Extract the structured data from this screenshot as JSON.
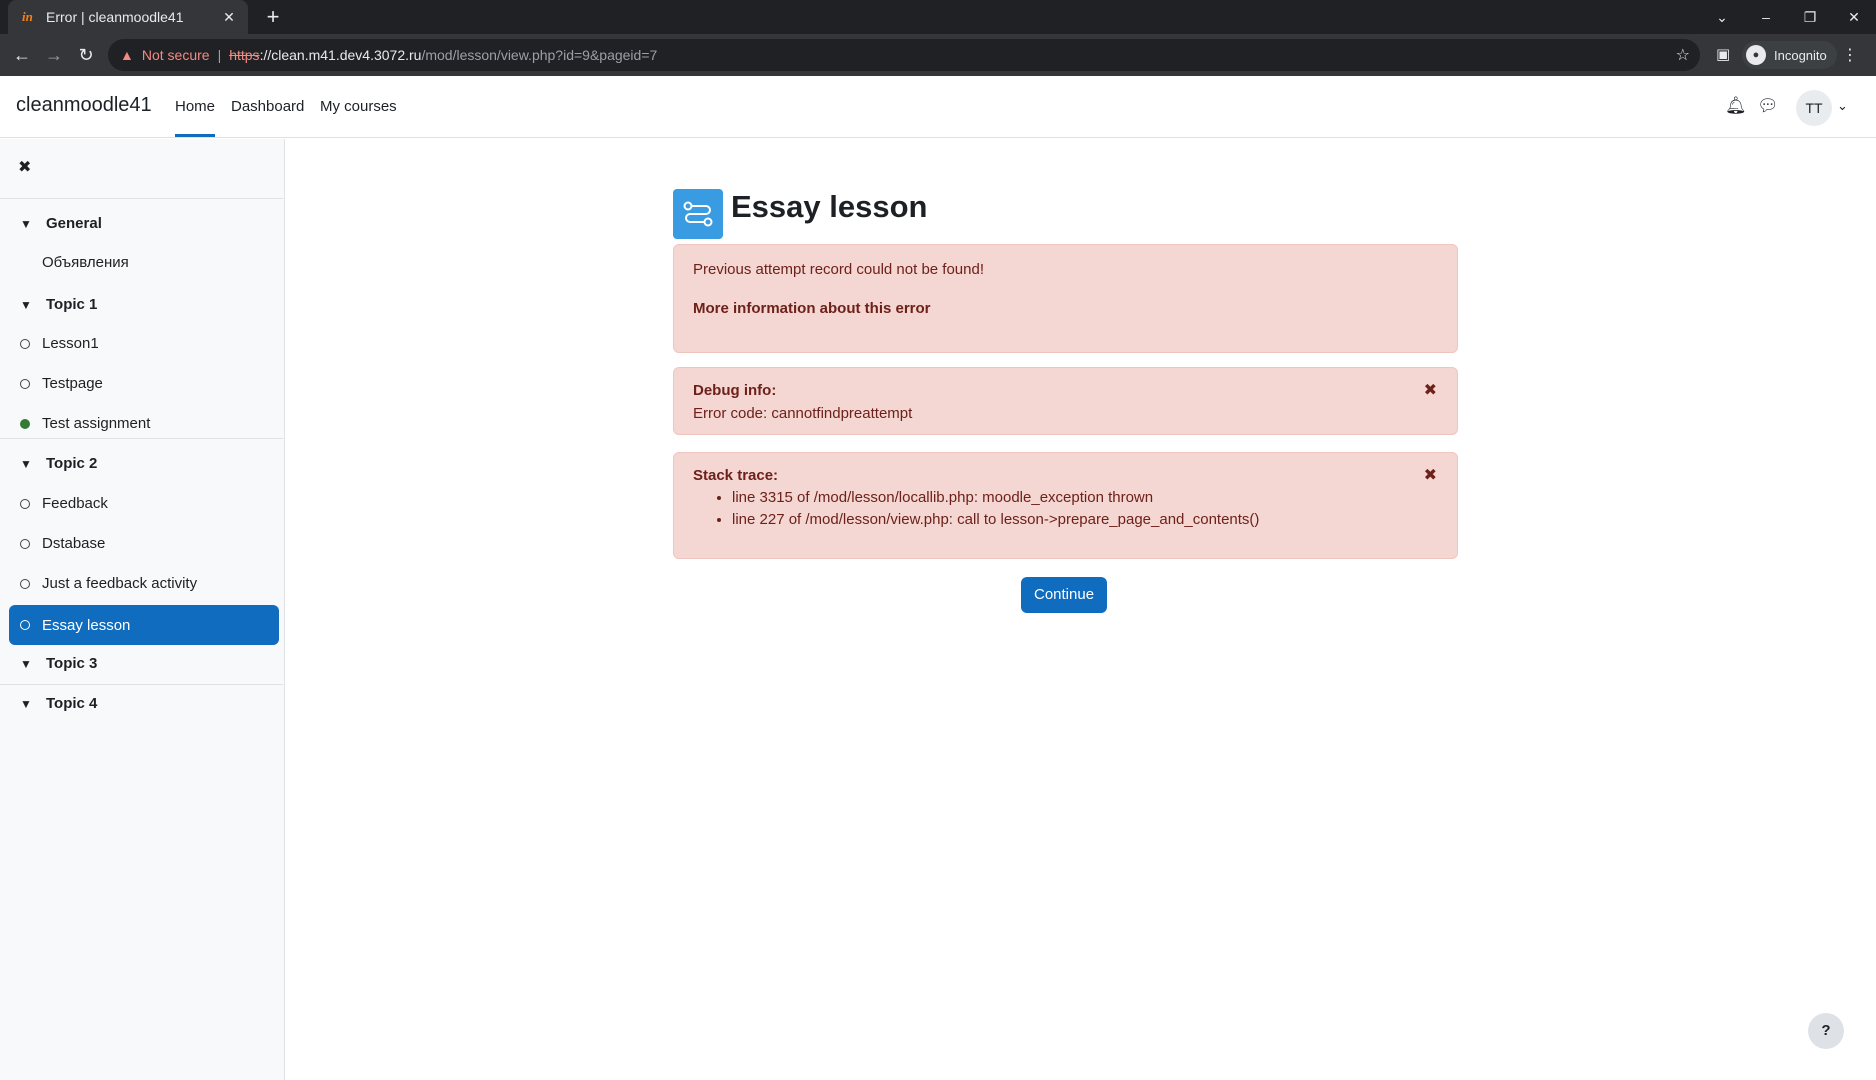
{
  "browser": {
    "tab_title": "Error | cleanmoodle41",
    "tab_favicon": "in",
    "new_tab": "+",
    "address": {
      "security_label": "Not secure",
      "scheme": "https",
      "host": "://clean.m41.dev4.3072.ru",
      "path": "/mod/lesson/view.php?id=9&pageid=7"
    },
    "incognito_label": "Incognito"
  },
  "header": {
    "brand": "cleanmoodle41",
    "nav": [
      "Home",
      "Dashboard",
      "My courses"
    ],
    "avatar_initials": "TT"
  },
  "drawer": {
    "sections": [
      {
        "title": "General",
        "items": [
          {
            "label": "Объявления",
            "status": "none"
          }
        ]
      },
      {
        "title": "Topic 1",
        "items": [
          {
            "label": "Lesson1",
            "status": "open"
          },
          {
            "label": "Testpage",
            "status": "open"
          },
          {
            "label": "Test assignment",
            "status": "done"
          }
        ]
      },
      {
        "title": "Topic 2",
        "items": [
          {
            "label": "Feedback",
            "status": "open"
          },
          {
            "label": "Dstabase",
            "status": "open"
          },
          {
            "label": "Just a feedback activity",
            "status": "open"
          },
          {
            "label": "Essay lesson",
            "status": "open",
            "active": true
          }
        ]
      },
      {
        "title": "Topic 3",
        "items": []
      },
      {
        "title": "Topic 4",
        "items": []
      }
    ]
  },
  "main": {
    "title": "Essay lesson",
    "error_message": "Previous attempt record could not be found!",
    "more_info_link": "More information about this error",
    "debug_title": "Debug info:",
    "debug_line": "Error code: cannotfindpreattempt",
    "stack_title": "Stack trace:",
    "stack_lines": [
      "line 3315 of /mod/lesson/locallib.php: moodle_exception thrown",
      "line 227 of /mod/lesson/view.php: call to lesson->prepare_page_and_contents()"
    ],
    "continue_label": "Continue",
    "help_label": "?"
  },
  "colors": {
    "brand_blue": "#0f6cbf",
    "alert_bg": "#f4d6d2",
    "alert_text": "#6e211a",
    "module_icon_bg": "#399be2",
    "complete_green": "#357a32"
  }
}
